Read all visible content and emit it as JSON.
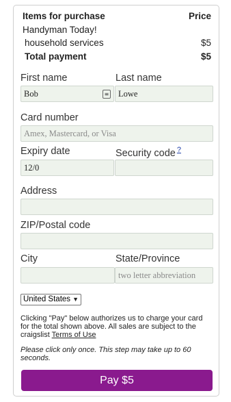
{
  "summary": {
    "header_left": "Items for purchase",
    "header_right": "Price",
    "item_group": "Handyman Today!",
    "item_name": "household services",
    "item_price": "$5",
    "total_label": "Total payment",
    "total_value": "$5"
  },
  "form": {
    "first_name_label": "First name",
    "first_name_value": "Bob",
    "last_name_label": "Last name",
    "last_name_value": "Lowe",
    "card_label": "Card number",
    "card_placeholder": "Amex, Mastercard, or Visa",
    "expiry_label": "Expiry date",
    "expiry_value": "12/0",
    "security_label": "Security code",
    "security_help": "?",
    "address_label": "Address",
    "zip_label": "ZIP/Postal code",
    "city_label": "City",
    "state_label": "State/Province",
    "state_placeholder": "two letter abbreviation",
    "country_selected": "United States"
  },
  "legal": {
    "text_before_link": "Clicking \"Pay\" below authorizes us to charge your card for the total shown above. All sales are subject to the craigslist ",
    "link_text": "Terms of Use",
    "note": "Please click only once. This step may take up to 60 seconds."
  },
  "pay_button_label": "Pay $5",
  "colors": {
    "pay_button": "#8a1a8e",
    "field_background": "#eef3ec"
  }
}
